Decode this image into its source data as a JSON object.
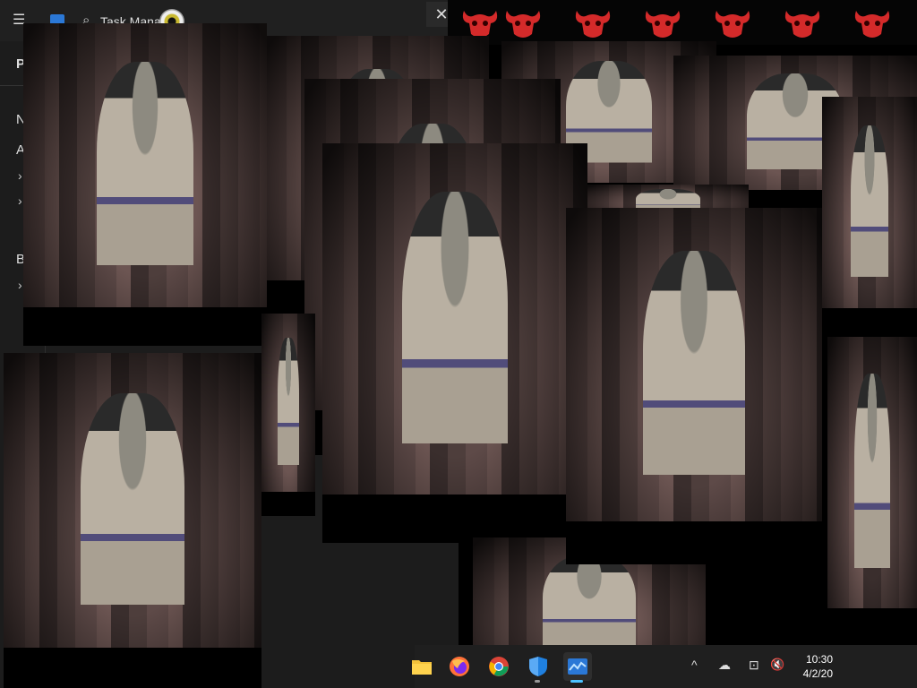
{
  "task_manager": {
    "title": "Task Manager",
    "close": "✕",
    "menu": "☰",
    "search": "⌕",
    "sidebar_letters": [
      "P",
      "N",
      "A",
      "B"
    ],
    "sidebar_chevrons": [
      "›",
      "›",
      "›"
    ]
  },
  "banner": {
    "icon": "red-demon-skull-icon",
    "count": 7,
    "color": "#d42a2a"
  },
  "taskbar": {
    "apps": [
      {
        "name": "file-explorer-icon"
      },
      {
        "name": "firefox-icon"
      },
      {
        "name": "chrome-icon"
      },
      {
        "name": "windows-security-icon"
      },
      {
        "name": "task-manager-icon"
      }
    ],
    "tray": {
      "chevron": "^",
      "onedrive": "☁",
      "network": "⊡",
      "volume": "🔇"
    },
    "time": "10:30",
    "date": "4/2/20"
  },
  "accent_color": "#4cc2ff"
}
